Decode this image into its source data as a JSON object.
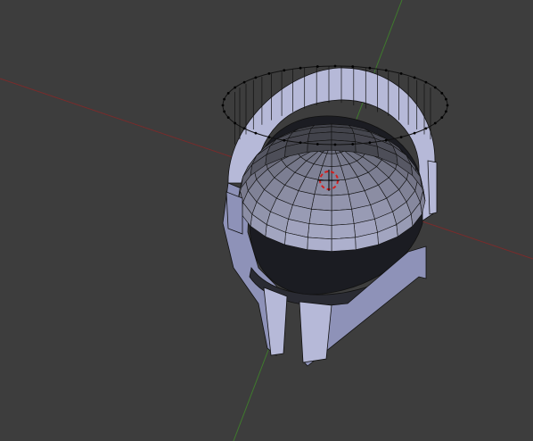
{
  "viewport": {
    "background_color": "#3d3d3d",
    "axis_x_color": "#7a2b2b",
    "axis_y_color": "#3f7a2d",
    "mesh_face_color": "#8e92b8",
    "mesh_face_light_color": "#b6b9d8",
    "mesh_edge_color": "#111111",
    "vertex_color": "#000000",
    "cursor_outer_color": "#d32020",
    "cursor_inner_color": "#ffffff",
    "wireframe_dome_rings": 8,
    "wireframe_dome_segments": 24,
    "wireframe_rim_segments": 28,
    "object_name": "",
    "mode": ""
  }
}
